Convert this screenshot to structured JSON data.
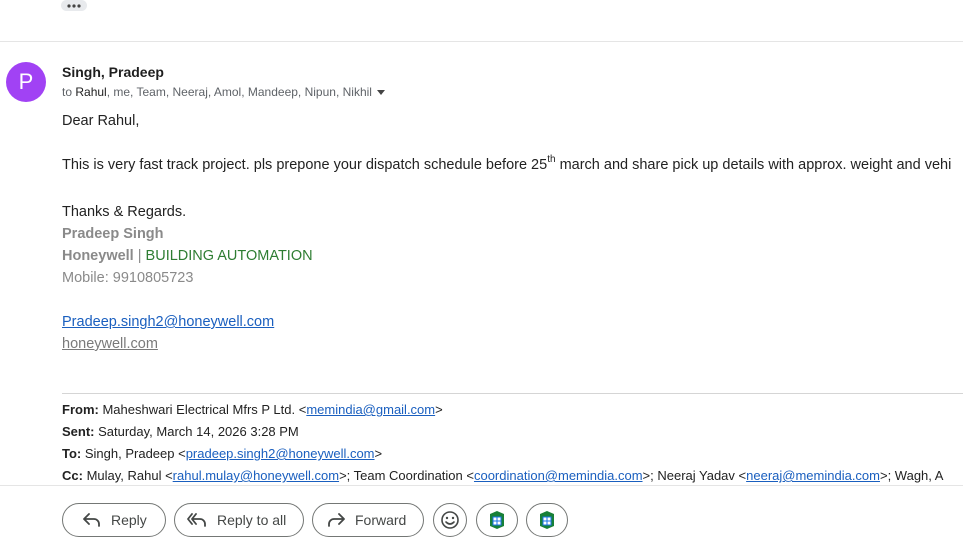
{
  "toolbar_top": {
    "more_icon": "more-horiz-icon"
  },
  "email": {
    "avatar_letter": "P",
    "avatar_color": "#a142f4",
    "sender_name": "Singh, Pradeep",
    "recipients_prefix": "to ",
    "recipients_first": "Rahul",
    "recipients_rest": ", me, Team, Neeraj, Amol, Mandeep, Nipun, Nikhil",
    "body": {
      "greeting": "Dear Rahul,",
      "message_part1": "This is very fast track project. pls prepone your dispatch schedule before 25",
      "message_sup": "th",
      "message_part2": " march and share pick up details with approx. weight and vehi",
      "thanks": "Thanks & Regards."
    },
    "signature": {
      "name": "Pradeep Singh",
      "company": "Honeywell",
      "separator": " | ",
      "division": "BUILDING AUTOMATION",
      "mobile": "Mobile: 9910805723",
      "email": "Pradeep.singh2@honeywell.com",
      "website": "honeywell.com"
    },
    "quoted": {
      "from_label": "From:",
      "from_name": " Maheshwari Electrical Mfrs P Ltd. <",
      "from_email": "memindia@gmail.com",
      "from_close": ">",
      "sent_label": "Sent:",
      "sent_value": " Saturday, March 14, 2026 3:28 PM",
      "to_label": "To:",
      "to_name": " Singh, Pradeep <",
      "to_email": "pradeep.singh2@honeywell.com",
      "to_close": ">",
      "cc_label": "Cc:",
      "cc_name1": " Mulay, Rahul <",
      "cc_email1": "rahul.mulay@honeywell.com",
      "cc_name2": ">; Team Coordination <",
      "cc_email2": "coordination@memindia.com",
      "cc_name3": ">; Neeraj Yadav <",
      "cc_email3": "neeraj@memindia.com",
      "cc_tail": ">; Wagh, A"
    }
  },
  "actions": {
    "reply": "Reply",
    "reply_all": "Reply to all",
    "forward": "Forward"
  },
  "colors": {
    "link": "#1a5fbf",
    "division_green": "#2e7d32",
    "sheets_green": "#188038",
    "sheets_blue": "#1a73e8"
  }
}
